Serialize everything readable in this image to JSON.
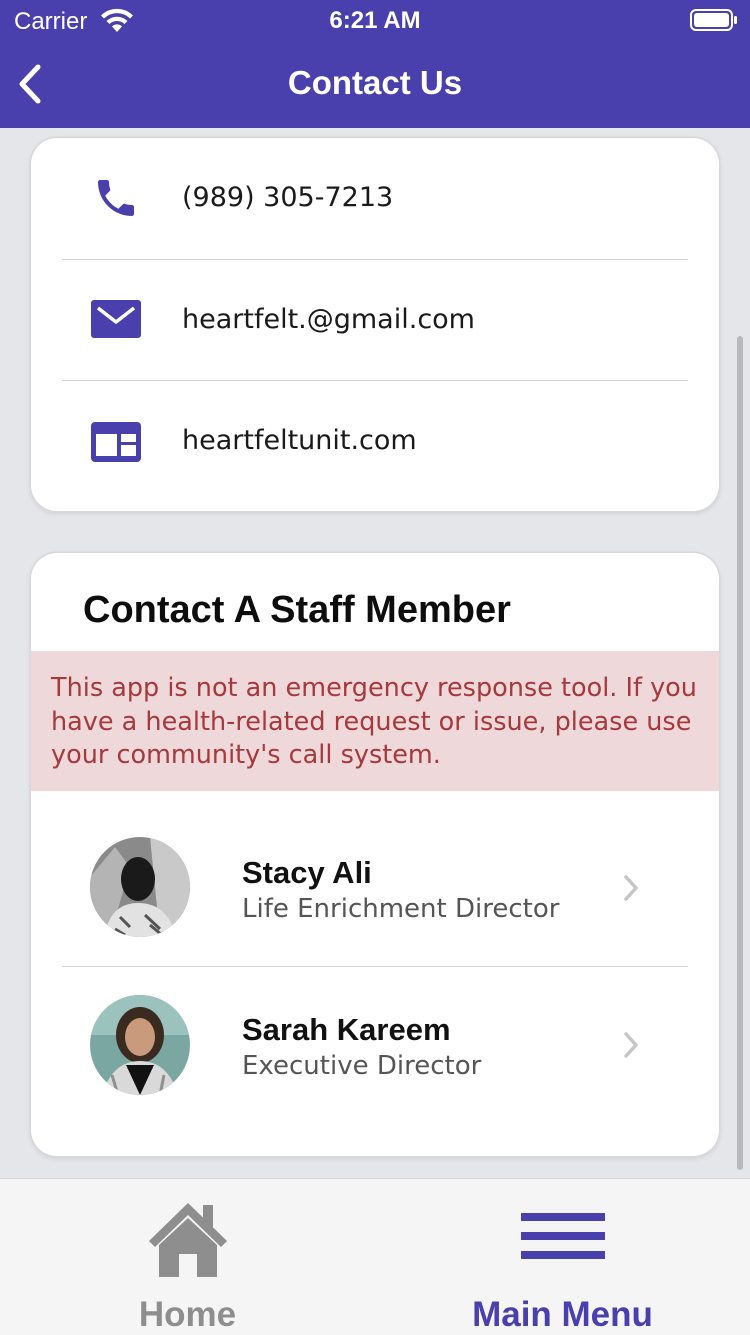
{
  "status_bar": {
    "carrier": "Carrier",
    "time": "6:21 AM"
  },
  "nav": {
    "title": "Contact Us",
    "back_icon": "chevron-left-icon"
  },
  "contact_info": [
    {
      "icon": "phone-icon",
      "value": "(989) 305-7213"
    },
    {
      "icon": "mail-icon",
      "value": "heartfelt.@gmail.com"
    },
    {
      "icon": "website-icon",
      "value": "heartfeltunit.com"
    }
  ],
  "staff": {
    "title": "Contact A Staff Member",
    "alert": "This app is not an emergency response tool. If you have a health-related request or issue, please use your community's call system.",
    "members": [
      {
        "name": "Stacy Ali",
        "role": "Life Enrichment Director"
      },
      {
        "name": "Sarah Kareem",
        "role": "Executive Director"
      }
    ]
  },
  "tabs": [
    {
      "label": "Home",
      "icon": "home-icon",
      "active": false
    },
    {
      "label": "Main Menu",
      "icon": "menu-icon",
      "active": true
    }
  ],
  "colors": {
    "brand": "#4a40ad",
    "background": "#e5e6ea",
    "alert_bg": "#efd8d9",
    "alert_text": "#a6393d",
    "tab_inactive": "#8e8e8e"
  }
}
